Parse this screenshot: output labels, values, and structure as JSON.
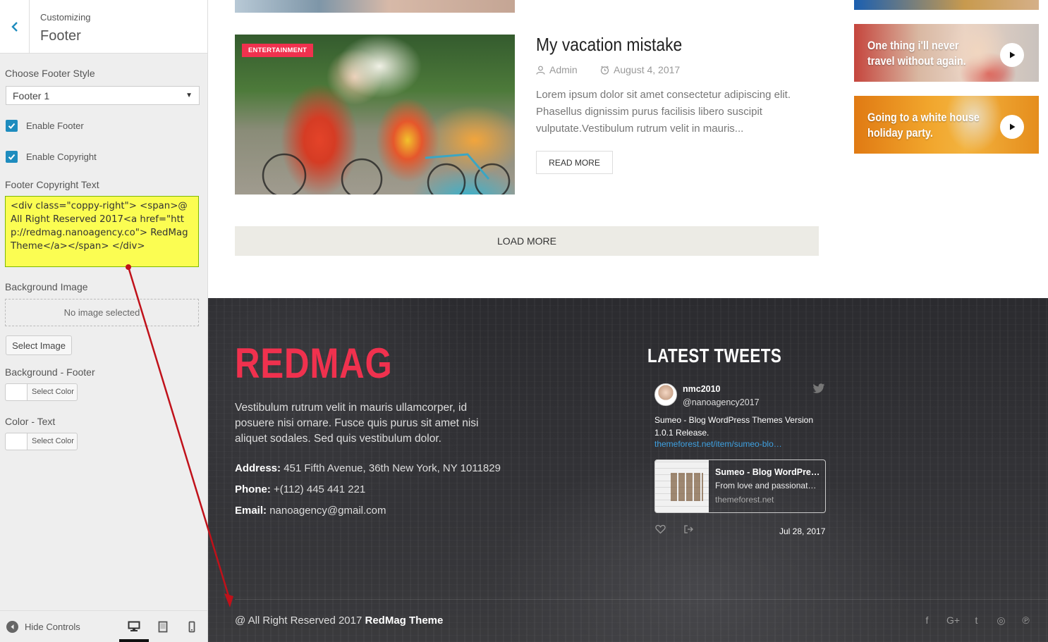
{
  "customizer": {
    "header": {
      "subtitle": "Customizing",
      "title": "Footer"
    },
    "footer_style": {
      "label": "Choose Footer Style",
      "value": "Footer 1"
    },
    "enable_footer": {
      "label": "Enable Footer",
      "checked": true
    },
    "enable_copyright": {
      "label": "Enable Copyright",
      "checked": true
    },
    "copyright_text": {
      "label": "Footer Copyright Text",
      "value": " <div class=\"coppy-right\"> <span>@ All Right Reserved 2017<a href=\"http://redmag.nanoagency.co\"> RedMag Theme</a></span> </div>"
    },
    "background_image": {
      "label": "Background Image",
      "placeholder": "No image selected",
      "button": "Select Image"
    },
    "background_footer": {
      "label": "Background - Footer",
      "button": "Select Color"
    },
    "color_text": {
      "label": "Color - Text",
      "button": "Select Color"
    },
    "bottom": {
      "hide_controls": "Hide Controls",
      "devices": [
        "desktop-icon",
        "tablet-icon",
        "mobile-icon"
      ],
      "active_device": "desktop"
    }
  },
  "preview": {
    "post": {
      "category": "ENTERTAINMENT",
      "title": "My vacation mistake",
      "author": "Admin",
      "date": "August 4, 2017",
      "excerpt": "Lorem ipsum dolor sit amet consectetur adipiscing elit. Phasellus dignissim purus facilisis libero suscipit vulputate.Vestibulum rutrum velit in mauris...",
      "read_more": "READ MORE"
    },
    "load_more": "LOAD MORE",
    "video_cards": [
      {
        "text": ""
      },
      {
        "text": "One thing i'll never travel without again."
      },
      {
        "text": "Going to a white house holiday party."
      }
    ],
    "footer": {
      "logo": "REDMAG",
      "description": "Vestibulum rutrum velit in mauris ullamcorper, id posuere nisi ornare. Fusce quis purus sit amet nisi aliquet sodales. Sed quis vestibulum dolor.",
      "address_label": "Address:",
      "address": "451 Fifth Avenue, 36th New York, NY 1011829",
      "phone_label": "Phone:",
      "phone": "+(112) 445 441 221",
      "email_label": "Email:",
      "email": "nanoagency@gmail.com",
      "tweets_title": "LATEST TWEETS",
      "tweet": {
        "name": "nmc2010",
        "handle": "@nanoagency2017",
        "text": "Sumeo - Blog WordPress Themes  Version 1.0.1 Release.",
        "link": "themeforest.net/item/sumeo-blo…",
        "card_title": "Sumeo - Blog WordPre…",
        "card_desc": "From love and passionat…",
        "card_domain": "themeforest.net",
        "date": "Jul 28, 2017"
      },
      "copyright_prefix": "@ All Right Reserved 2017",
      "copyright_brand": "RedMag Theme",
      "social": [
        "facebook-icon",
        "google-plus-icon",
        "twitter-icon",
        "instagram-icon",
        "pinterest-icon"
      ],
      "social_glyphs": [
        "f",
        "G+",
        "t",
        "◎",
        "℗"
      ]
    }
  },
  "colors": {
    "brand_red": "#f0314e",
    "wp_blue": "#1e8cbe",
    "highlight": "#fbfd52",
    "annotation_arrow": "#c0111a"
  }
}
